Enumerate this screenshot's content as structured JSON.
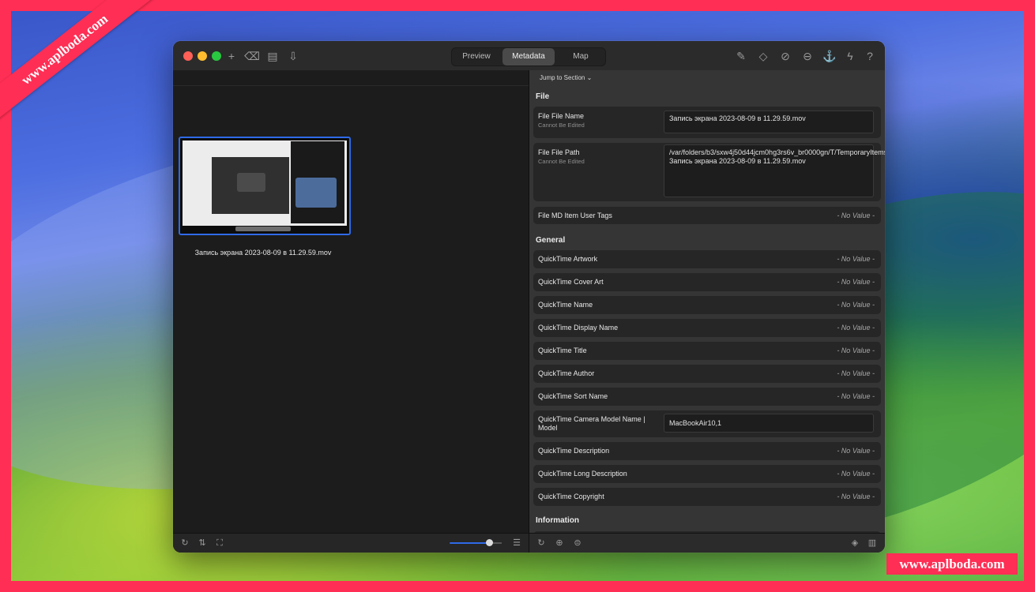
{
  "watermarks": {
    "ribbon": "www.aplboda.com",
    "badge": "www.aplboda.com"
  },
  "titlebar": {
    "tabs": [
      {
        "label": "Preview",
        "active": false
      },
      {
        "label": "Metadata",
        "active": true
      },
      {
        "label": "Map",
        "active": false
      }
    ],
    "left_icons": [
      "add-icon",
      "delete-icon",
      "document-icon",
      "import-icon"
    ],
    "right_icons": [
      "edit-icon",
      "eraser-icon",
      "blocked-icon",
      "more-icon",
      "export-icon",
      "lightning-icon",
      "help-icon"
    ]
  },
  "file_browser": {
    "thumbnail_caption": "Запись экрана 2023-08-09 в 11.29.59.mov",
    "bottom_icons": [
      "rotate-icon",
      "sort-icon",
      "select-icon",
      "list-view-icon"
    ],
    "zoom_level": 0.78
  },
  "metadata": {
    "jump_label": "Jump to Section",
    "sections": {
      "file": "File",
      "general": "General",
      "information": "Information"
    },
    "file_rows": {
      "file_name": {
        "label": "File File Name",
        "sub": "Cannot Be Edited",
        "value": "Запись экрана 2023-08-09 в 11.29.59.mov"
      },
      "file_path": {
        "label": "File File Path",
        "sub": "Cannot Be Edited",
        "value": "/var/folders/b3/sxw4j50d44jcm0hg3rs6v_br0000gn/T/TemporaryItems/NSIRD_screencaptureui_fluZby/Запись экрана 2023-08-09 в 11.29.59.mov"
      },
      "user_tags": {
        "label": "File MD Item User Tags",
        "value": "- No Value -"
      }
    },
    "general_rows": [
      {
        "label": "QuickTime Artwork",
        "value": "- No Value -"
      },
      {
        "label": "QuickTime Cover Art",
        "value": "- No Value -"
      },
      {
        "label": "QuickTime Name",
        "value": "- No Value -"
      },
      {
        "label": "QuickTime Display Name",
        "value": "- No Value -"
      },
      {
        "label": "QuickTime Title",
        "value": "- No Value -"
      },
      {
        "label": "QuickTime Author",
        "value": "- No Value -"
      },
      {
        "label": "QuickTime Sort Name",
        "value": "- No Value -"
      }
    ],
    "camera_row": {
      "label": "QuickTime Camera Model Name | Model",
      "value": "MacBookAir10,1"
    },
    "general_rows_2": [
      {
        "label": "QuickTime Description",
        "value": "- No Value -"
      },
      {
        "label": "QuickTime Long Description",
        "value": "- No Value -"
      },
      {
        "label": "QuickTime Copyright",
        "value": "- No Value -"
      }
    ],
    "bottom_icons": [
      "rotate-icon",
      "globe-icon",
      "filter-icon",
      "tag-icon",
      "sidebar-icon"
    ]
  }
}
